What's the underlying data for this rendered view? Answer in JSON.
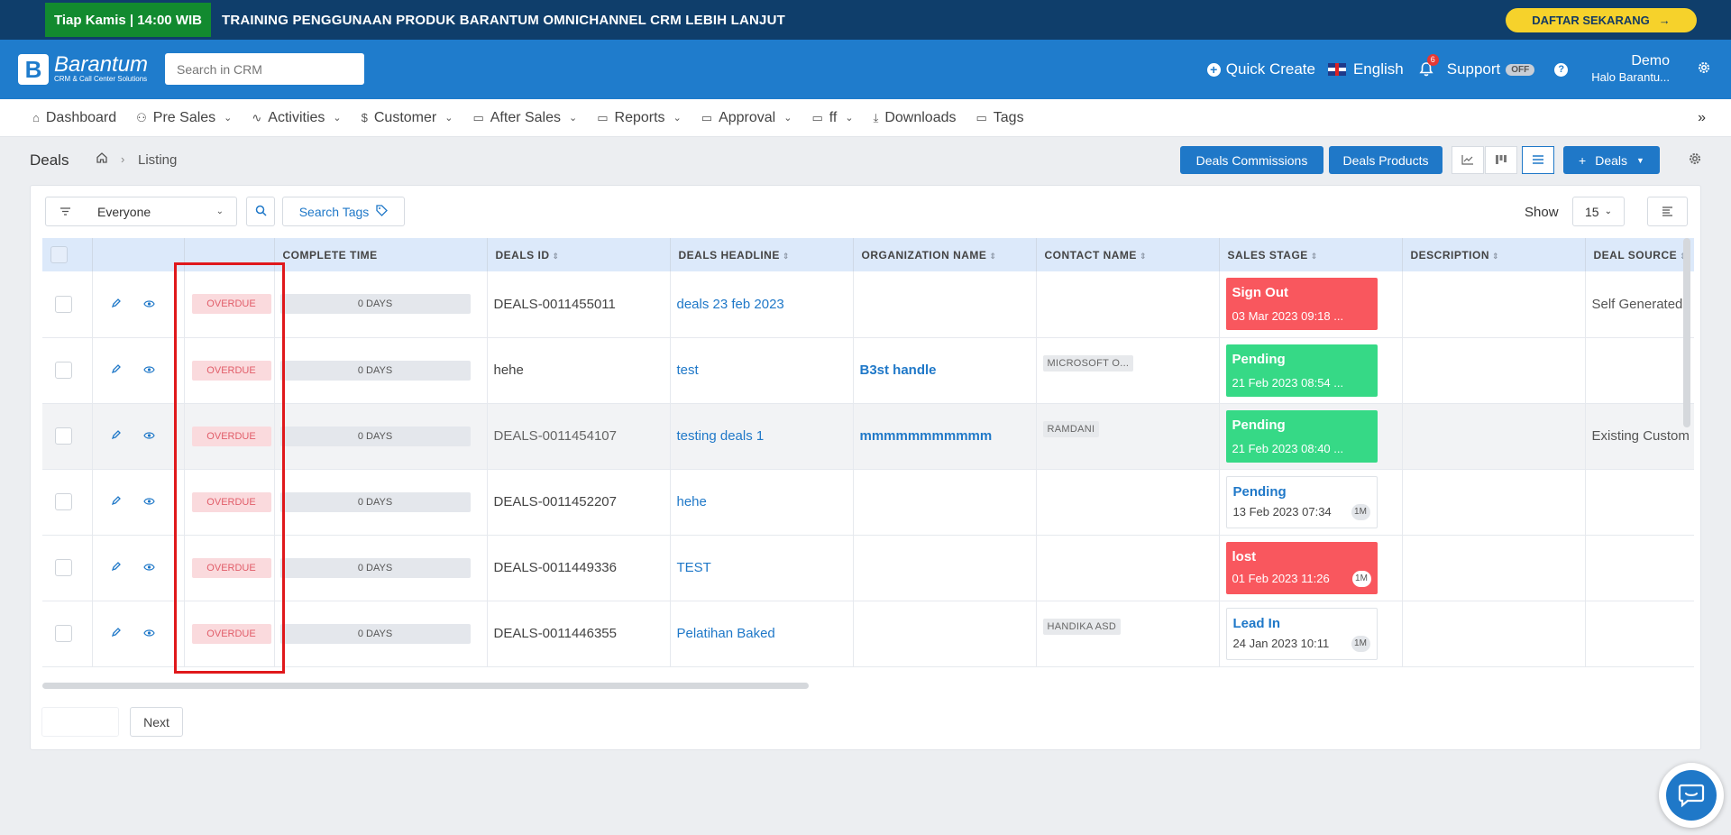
{
  "promo": {
    "badge": "Tiap Kamis | 14:00 WIB",
    "text": "TRAINING PENGGUNAAN PRODUK BARANTUM OMNICHANNEL CRM LEBIH LANJUT",
    "cta": "DAFTAR SEKARANG",
    "cta_icon": "arrow-right-icon",
    "colors": {
      "bar": "#0f3e6b",
      "badge": "#128a2f",
      "cta": "#f6d22b"
    }
  },
  "header": {
    "logo_name": "Barantum",
    "logo_sub": "CRM & Call Center Solutions",
    "search_placeholder": "Search in CRM",
    "quick_create": "Quick Create",
    "language": "English",
    "notification_count": "6",
    "support": "Support",
    "support_toggle": "OFF",
    "help": "?",
    "user_name": "Demo",
    "user_sub": "Halo Barantu...",
    "colors": {
      "background": "#1f7ccc"
    }
  },
  "menu": {
    "items": [
      {
        "label": "Dashboard",
        "icon": "home-icon",
        "dropdown": false
      },
      {
        "label": "Pre Sales",
        "icon": "users-icon",
        "dropdown": true
      },
      {
        "label": "Activities",
        "icon": "activity-icon",
        "dropdown": true
      },
      {
        "label": "Customer",
        "icon": "dollar-icon",
        "dropdown": true
      },
      {
        "label": "After Sales",
        "icon": "folder-icon",
        "dropdown": true
      },
      {
        "label": "Reports",
        "icon": "folder-icon",
        "dropdown": true
      },
      {
        "label": "Approval",
        "icon": "folder-icon",
        "dropdown": true
      },
      {
        "label": "ff",
        "icon": "folder-icon",
        "dropdown": true
      },
      {
        "label": "Downloads",
        "icon": "download-icon",
        "dropdown": false
      },
      {
        "label": "Tags",
        "icon": "folder-icon",
        "dropdown": false
      }
    ]
  },
  "subheader": {
    "title": "Deals",
    "breadcrumb_current": "Listing",
    "btn_commissions": "Deals Commissions",
    "btn_products": "Deals Products",
    "btn_add": "Deals"
  },
  "toolbar": {
    "filter_value": "Everyone",
    "search_tags": "Search Tags",
    "show_label": "Show",
    "show_value": "15"
  },
  "table": {
    "columns": [
      "",
      "",
      "",
      "COMPLETE TIME",
      "DEALS ID",
      "DEALS HEADLINE",
      "ORGANIZATION NAME",
      "CONTACT NAME",
      "SALES STAGE",
      "DESCRIPTION",
      "DEAL SOURCE"
    ],
    "rows": [
      {
        "status": "OVERDUE",
        "complete_time": "0 DAYS",
        "deals_id": "DEALS-0011455011",
        "headline": "deals 23 feb 2023",
        "organization": "",
        "contact": "",
        "stage": "Sign Out",
        "stage_time": "03 Mar 2023 09:18 ...",
        "stage_badge": "",
        "stage_style": "red",
        "description": "",
        "source": "Self Generated"
      },
      {
        "status": "OVERDUE",
        "complete_time": "0 DAYS",
        "deals_id": "hehe",
        "headline": "test",
        "organization": "B3st handle",
        "contact": "MICROSOFT O...",
        "stage": "Pending",
        "stage_time": "21 Feb 2023 08:54 ...",
        "stage_badge": "",
        "stage_style": "green",
        "description": "",
        "source": ""
      },
      {
        "status": "OVERDUE",
        "complete_time": "0 DAYS",
        "deals_id": "DEALS-0011454107",
        "headline": "testing deals 1",
        "organization": "mmmmmmmmmmm",
        "contact": "RAMDANI",
        "stage": "Pending",
        "stage_time": "21 Feb 2023 08:40 ...",
        "stage_badge": "",
        "stage_style": "green",
        "description": "",
        "source": "Existing Custom"
      },
      {
        "status": "OVERDUE",
        "complete_time": "0 DAYS",
        "deals_id": "DEALS-0011452207",
        "headline": "hehe",
        "organization": "",
        "contact": "",
        "stage": "Pending",
        "stage_time": "13 Feb 2023 07:34",
        "stage_badge": "1M",
        "stage_style": "white",
        "description": "",
        "source": ""
      },
      {
        "status": "OVERDUE",
        "complete_time": "0 DAYS",
        "deals_id": "DEALS-0011449336",
        "headline": "TEST",
        "organization": "",
        "contact": "",
        "stage": "lost",
        "stage_time": "01 Feb 2023 11:26",
        "stage_badge": "1M",
        "stage_style": "red",
        "description": "",
        "source": ""
      },
      {
        "status": "OVERDUE",
        "complete_time": "0 DAYS",
        "deals_id": "DEALS-0011446355",
        "headline": "Pelatihan Baked",
        "organization": "",
        "contact": "HANDIKA ASD",
        "stage": "Lead In",
        "stage_time": "24 Jan 2023 10:11",
        "stage_badge": "1M",
        "stage_style": "white",
        "description": "",
        "source": ""
      }
    ]
  },
  "pagination": {
    "next": "Next"
  },
  "colors": {
    "accent": "#1f78c8",
    "overdue_bg": "#fadadd",
    "overdue_text": "#e15d69",
    "stage_red": "#f9575e",
    "stage_green": "#36d986",
    "highlight": "#e0181b"
  }
}
